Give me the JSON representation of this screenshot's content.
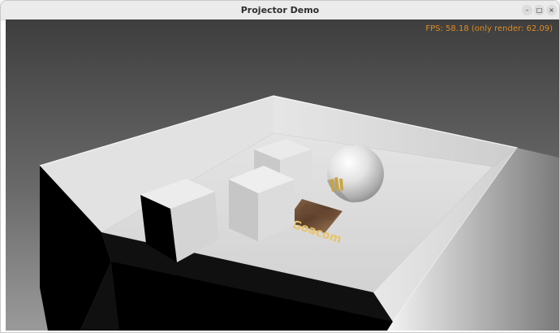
{
  "window": {
    "title": "Projector Demo",
    "controls": {
      "minimize": "–",
      "maximize": "□",
      "close": "×"
    }
  },
  "viewport": {
    "fps_text": "FPS: 58.18 (only render: 62.09)",
    "overlay_color": "#e08a1e",
    "projected_texture_text": "Goacom"
  }
}
